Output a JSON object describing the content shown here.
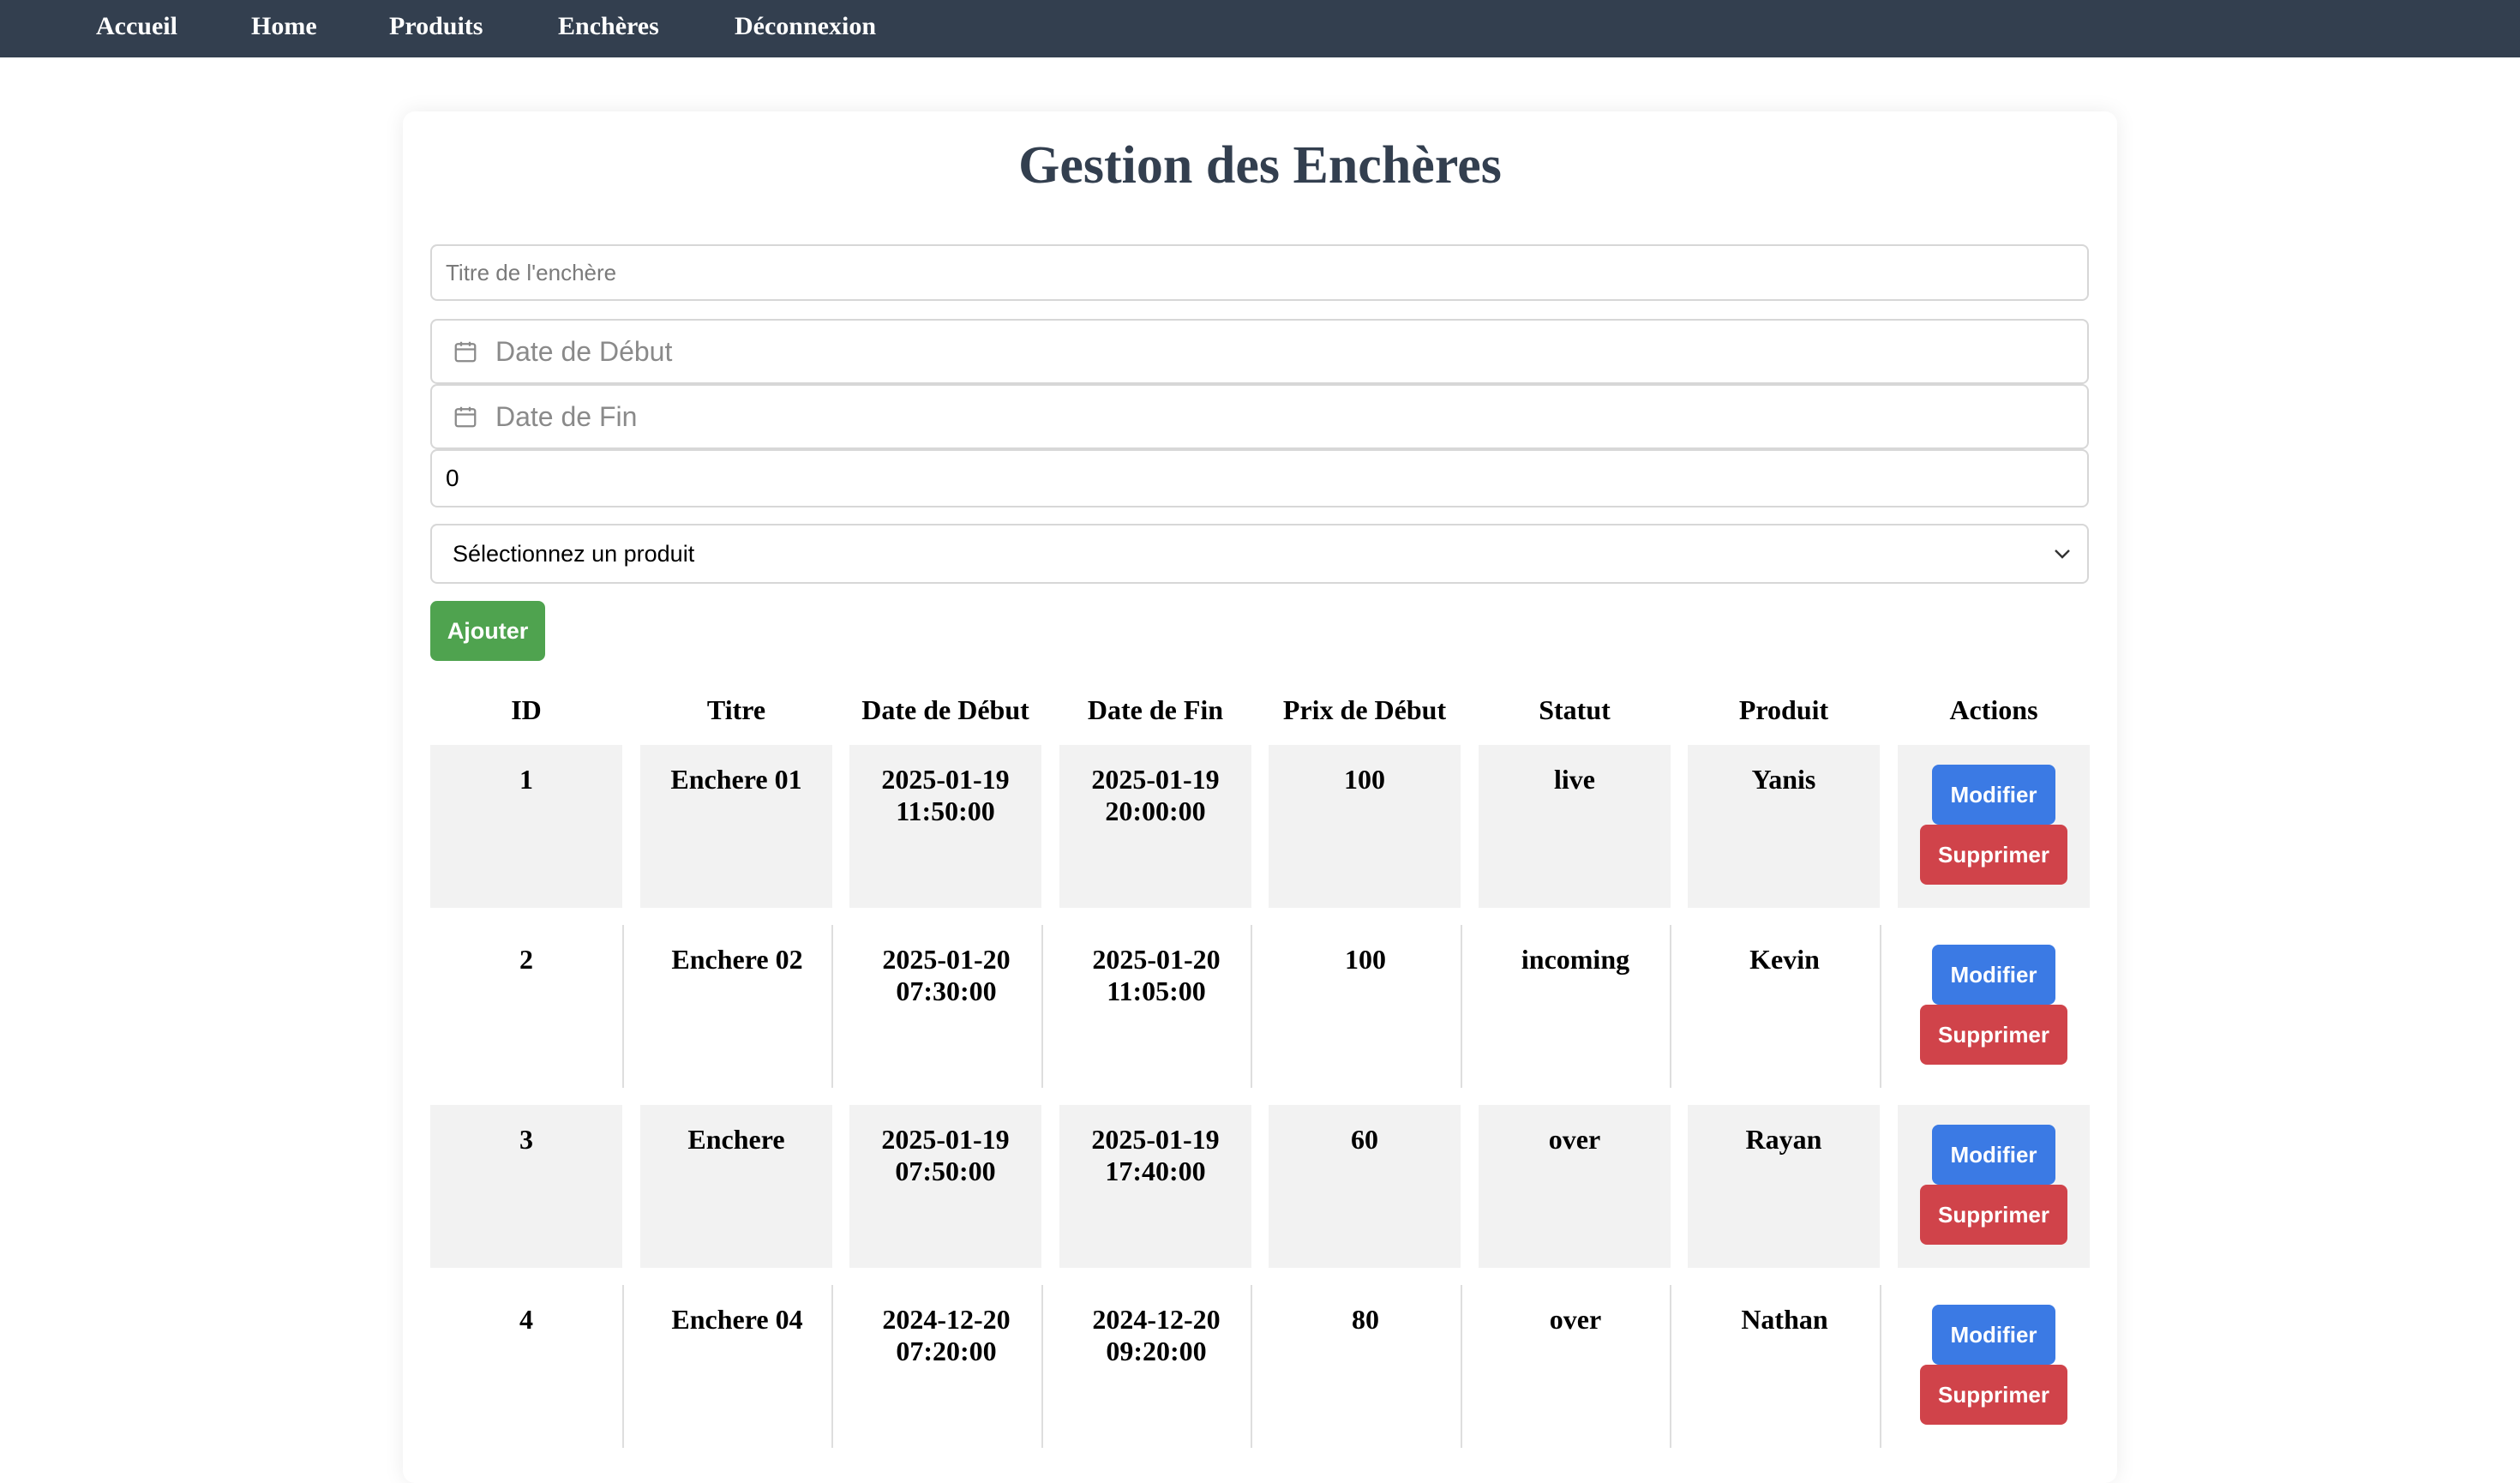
{
  "nav": {
    "items": [
      "Accueil",
      "Home",
      "Produits",
      "Enchères",
      "Déconnexion"
    ]
  },
  "page": {
    "title": "Gestion des Enchères"
  },
  "form": {
    "title_placeholder": "Titre de l'enchère",
    "start_date_placeholder": "Date de Début",
    "end_date_placeholder": "Date de Fin",
    "price_value": "0",
    "product_select_value": "Sélectionnez un produit",
    "add_label": "Ajouter"
  },
  "table": {
    "headers": [
      "ID",
      "Titre",
      "Date de Début",
      "Date de Fin",
      "Prix de Début",
      "Statut",
      "Produit",
      "Actions"
    ],
    "rows": [
      {
        "id": "1",
        "title": "Enchere 01",
        "start_date": "2025-01-19",
        "start_time": "11:50:00",
        "end_date": "2025-01-19",
        "end_time": "20:00:00",
        "price": "100",
        "status": "live",
        "product": "Yanis"
      },
      {
        "id": "2",
        "title": "Enchere 02",
        "start_date": "2025-01-20",
        "start_time": "07:30:00",
        "end_date": "2025-01-20",
        "end_time": "11:05:00",
        "price": "100",
        "status": "incoming",
        "product": "Kevin"
      },
      {
        "id": "3",
        "title": "Enchere",
        "start_date": "2025-01-19",
        "start_time": "07:50:00",
        "end_date": "2025-01-19",
        "end_time": "17:40:00",
        "price": "60",
        "status": "over",
        "product": "Rayan"
      },
      {
        "id": "4",
        "title": "Enchere 04",
        "start_date": "2024-12-20",
        "start_time": "07:20:00",
        "end_date": "2024-12-20",
        "end_time": "09:20:00",
        "price": "80",
        "status": "over",
        "product": "Nathan"
      }
    ],
    "edit_label": "Modifier",
    "delete_label": "Supprimer"
  },
  "icons": {
    "calendar": "calendar-icon",
    "chevron": "chevron-down-icon"
  },
  "colors": {
    "navbar": "#333f4f",
    "title": "#333f4f",
    "add_button": "#4fa34f",
    "edit_button": "#3b7ae4",
    "delete_button": "#d0434a",
    "row_shade": "#f2f2f2"
  }
}
